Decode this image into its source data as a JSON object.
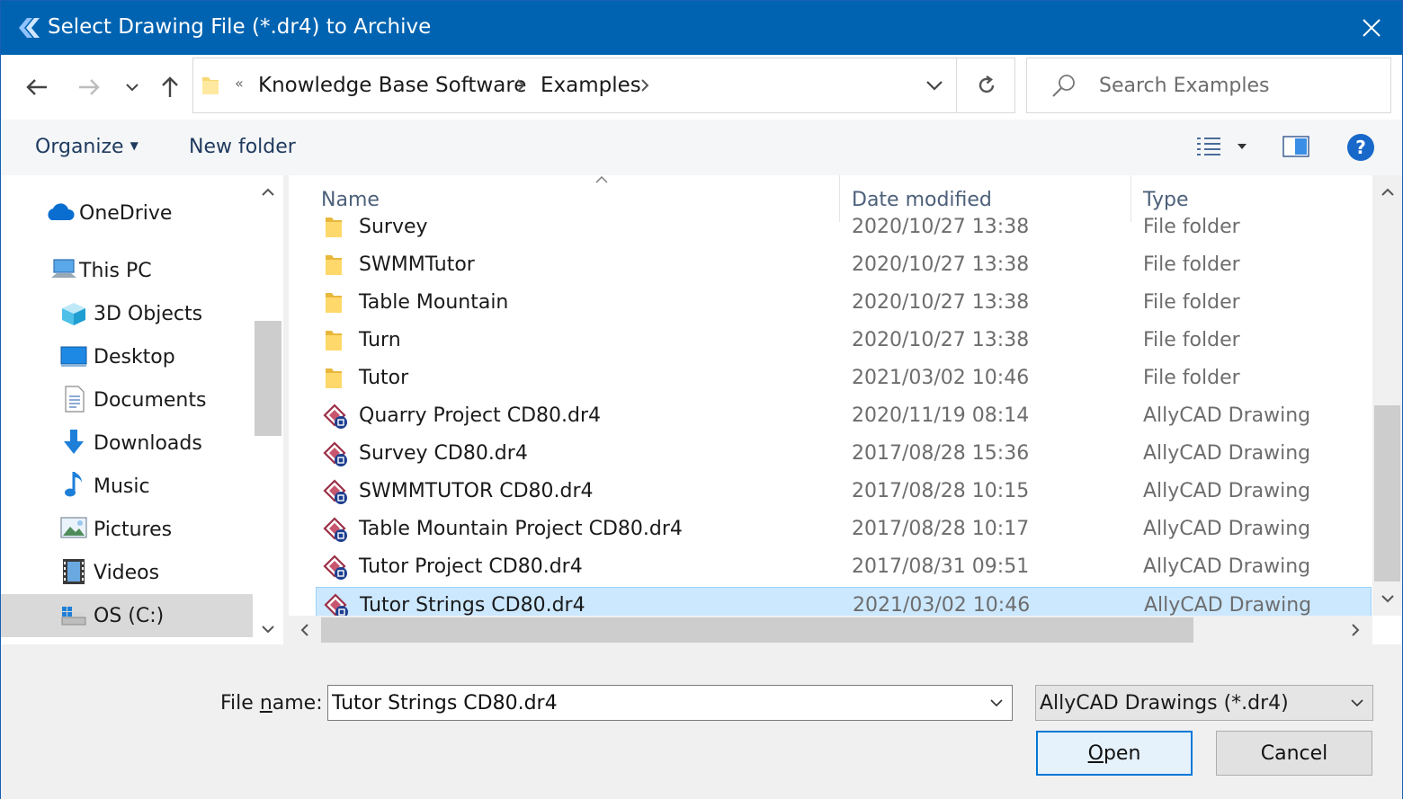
{
  "window": {
    "title": "Select Drawing File (*.dr4) to Archive"
  },
  "address": {
    "overflow": "«",
    "breadcrumbs": [
      "Knowledge Base Software",
      "Examples"
    ]
  },
  "search": {
    "placeholder": "Search Examples"
  },
  "toolbar": {
    "organize": "Organize",
    "new_folder": "New folder"
  },
  "nav": {
    "items": [
      {
        "label": "OneDrive",
        "icon": "onedrive-icon"
      },
      {
        "label": "This PC",
        "icon": "computer-icon"
      },
      {
        "label": "3D Objects",
        "icon": "3d-objects-icon"
      },
      {
        "label": "Desktop",
        "icon": "desktop-icon"
      },
      {
        "label": "Documents",
        "icon": "documents-icon"
      },
      {
        "label": "Downloads",
        "icon": "downloads-icon"
      },
      {
        "label": "Music",
        "icon": "music-icon"
      },
      {
        "label": "Pictures",
        "icon": "pictures-icon"
      },
      {
        "label": "Videos",
        "icon": "videos-icon"
      },
      {
        "label": "OS (C:)",
        "icon": "drive-icon"
      }
    ],
    "selected": "OS (C:)"
  },
  "columns": {
    "name": "Name",
    "date": "Date modified",
    "type": "Type"
  },
  "files": [
    {
      "name": "Survey",
      "date": "2020/10/27 13:38",
      "type": "File folder",
      "kind": "folder"
    },
    {
      "name": "SWMMTutor",
      "date": "2020/10/27 13:38",
      "type": "File folder",
      "kind": "folder"
    },
    {
      "name": "Table Mountain",
      "date": "2020/10/27 13:38",
      "type": "File folder",
      "kind": "folder"
    },
    {
      "name": "Turn",
      "date": "2020/10/27 13:38",
      "type": "File folder",
      "kind": "folder"
    },
    {
      "name": "Tutor",
      "date": "2021/03/02 10:46",
      "type": "File folder",
      "kind": "folder"
    },
    {
      "name": "Quarry Project CD80.dr4",
      "date": "2020/11/19 08:14",
      "type": "AllyCAD Drawing",
      "kind": "drawing"
    },
    {
      "name": "Survey CD80.dr4",
      "date": "2017/08/28 15:36",
      "type": "AllyCAD Drawing",
      "kind": "drawing"
    },
    {
      "name": "SWMMTUTOR CD80.dr4",
      "date": "2017/08/28 10:15",
      "type": "AllyCAD Drawing",
      "kind": "drawing"
    },
    {
      "name": "Table Mountain Project CD80.dr4",
      "date": "2017/08/28 10:17",
      "type": "AllyCAD Drawing",
      "kind": "drawing"
    },
    {
      "name": "Tutor Project CD80.dr4",
      "date": "2017/08/31 09:51",
      "type": "AllyCAD Drawing",
      "kind": "drawing"
    },
    {
      "name": "Tutor Strings CD80.dr4",
      "date": "2021/03/02 10:46",
      "type": "AllyCAD Drawing",
      "kind": "drawing",
      "selected": true
    }
  ],
  "footer": {
    "file_name_label_pre": "File ",
    "file_name_label_mnemonic": "n",
    "file_name_label_post": "ame:",
    "file_name_value": "Tutor Strings CD80.dr4",
    "file_type_value": "AllyCAD Drawings (*.dr4)",
    "open_mnemonic": "O",
    "open_rest": "pen",
    "cancel": "Cancel"
  },
  "colors": {
    "titlebar": "#0063b1",
    "selection": "#cce8ff",
    "accent": "#0078d7"
  }
}
